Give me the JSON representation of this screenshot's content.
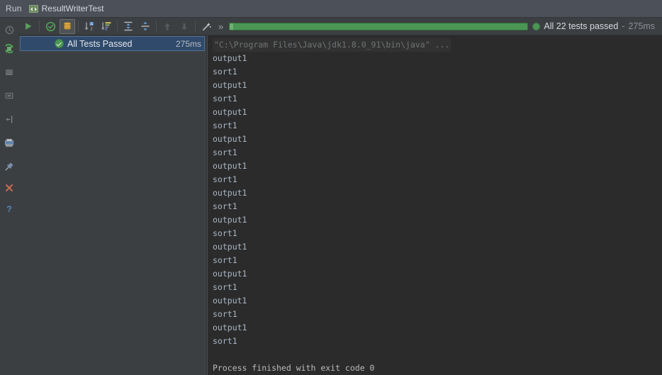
{
  "window": {
    "tool_label": "Run",
    "tab_name": "ResultWriterTest",
    "run_config_icon": "run-configuration-icon"
  },
  "toolbar": {
    "buttons": [
      {
        "name": "rerun-button",
        "icon": "play-icon",
        "tooltip": "Rerun",
        "enabled": true,
        "pressed": false
      },
      {
        "name": "show-passed-button",
        "icon": "ok-circle-icon",
        "tooltip": "Show Passed",
        "enabled": true,
        "pressed": false
      },
      {
        "name": "show-ignored-button",
        "icon": "ignored-stack-icon",
        "tooltip": "Show Ignored",
        "enabled": true,
        "pressed": true
      },
      {
        "name": "sort-alphabetically-button",
        "icon": "sort-alpha-icon",
        "tooltip": "Sort Alphabetically",
        "enabled": true,
        "pressed": false
      },
      {
        "name": "sort-by-duration-button",
        "icon": "sort-duration-icon",
        "tooltip": "Sort by Duration",
        "enabled": true,
        "pressed": false
      },
      {
        "name": "expand-all-button",
        "icon": "expand-all-icon",
        "tooltip": "Expand All",
        "enabled": true,
        "pressed": false
      },
      {
        "name": "collapse-all-button",
        "icon": "collapse-all-icon",
        "tooltip": "Collapse All",
        "enabled": true,
        "pressed": false
      },
      {
        "name": "prev-failed-test-button",
        "icon": "arrow-up-icon",
        "tooltip": "Previous Failed Test",
        "enabled": false,
        "pressed": false
      },
      {
        "name": "next-failed-test-button",
        "icon": "arrow-down-icon",
        "tooltip": "Next Failed Test",
        "enabled": false,
        "pressed": false
      },
      {
        "name": "settings-button",
        "icon": "magic-wand-icon",
        "tooltip": "Test Runner Settings",
        "enabled": true,
        "pressed": false
      }
    ],
    "overflow_label": "»"
  },
  "status": {
    "icon": "green-status-dot",
    "message": "All 22 tests passed",
    "separator": "-",
    "duration": "275ms",
    "progress_percent": 100,
    "progress_color": "#4b9654"
  },
  "sidebar": {
    "items": [
      {
        "name": "sidebar-item-history",
        "icon": "history-clock-icon",
        "label": ""
      },
      {
        "name": "sidebar-item-import-tests",
        "icon": "import-tests-icon",
        "label": ""
      },
      {
        "name": "sidebar-item-stop",
        "icon": "stop-square-icon",
        "label": ""
      },
      {
        "name": "sidebar-item-dump-threads",
        "icon": "dump-threads-icon",
        "label": ""
      },
      {
        "name": "sidebar-item-soft-wrap",
        "icon": "soft-wrap-icon",
        "label": ""
      },
      {
        "name": "sidebar-item-print",
        "icon": "print-icon",
        "label": ""
      },
      {
        "name": "sidebar-item-pin-tab",
        "icon": "pin-icon",
        "label": ""
      },
      {
        "name": "sidebar-item-close",
        "icon": "close-x-icon",
        "label": ""
      },
      {
        "name": "sidebar-item-help",
        "icon": "question-mark-icon",
        "label": ""
      }
    ]
  },
  "test_tree": {
    "rows": [
      {
        "name": "test-tree-row-all-tests-passed",
        "icon": "green-check-icon",
        "label": "All Tests Passed",
        "duration": "275ms",
        "selected": true
      }
    ]
  },
  "console": {
    "lines": [
      {
        "text": "\"C:\\Program Files\\Java\\jdk1.8.0_91\\bin\\java\" ...",
        "style": "cmd"
      },
      {
        "text": "output1",
        "style": "normal"
      },
      {
        "text": "sort1",
        "style": "normal"
      },
      {
        "text": "output1",
        "style": "normal"
      },
      {
        "text": "sort1",
        "style": "normal"
      },
      {
        "text": "output1",
        "style": "normal"
      },
      {
        "text": "sort1",
        "style": "normal"
      },
      {
        "text": "output1",
        "style": "normal"
      },
      {
        "text": "sort1",
        "style": "normal"
      },
      {
        "text": "output1",
        "style": "normal"
      },
      {
        "text": "sort1",
        "style": "normal"
      },
      {
        "text": "output1",
        "style": "normal"
      },
      {
        "text": "sort1",
        "style": "normal"
      },
      {
        "text": "output1",
        "style": "normal"
      },
      {
        "text": "sort1",
        "style": "normal"
      },
      {
        "text": "output1",
        "style": "normal"
      },
      {
        "text": "sort1",
        "style": "normal"
      },
      {
        "text": "output1",
        "style": "normal"
      },
      {
        "text": "sort1",
        "style": "normal"
      },
      {
        "text": "output1",
        "style": "normal"
      },
      {
        "text": "sort1",
        "style": "normal"
      },
      {
        "text": "output1",
        "style": "normal"
      },
      {
        "text": "sort1",
        "style": "normal"
      },
      {
        "text": "",
        "style": "blank"
      },
      {
        "text": "Process finished with exit code 0",
        "style": "final"
      }
    ]
  },
  "colors": {
    "window_bg": "#3c3f41",
    "titlebar_bg": "#4b5059",
    "console_bg": "#2b2b2b",
    "console_text": "#a9b7c6",
    "selection_bg": "#2f4a6b",
    "success_green": "#4b9654",
    "muted_text": "#8b9098"
  }
}
